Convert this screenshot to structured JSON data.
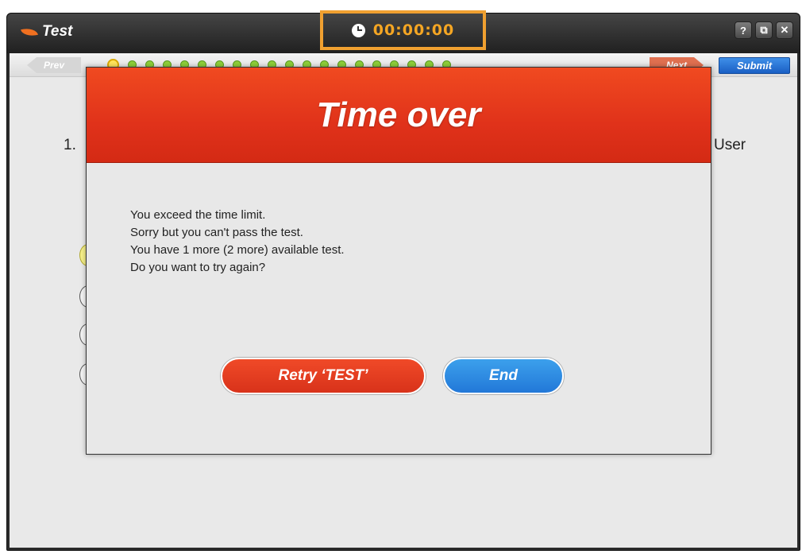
{
  "window": {
    "title": "Test",
    "timer": "00:00:00",
    "buttons": {
      "help": "?",
      "restore": "⧉",
      "close": "✕"
    }
  },
  "nav": {
    "prev_label": "Prev",
    "next_label": "Next",
    "submit_label": "Submit",
    "question_count": 20,
    "current_question": 1
  },
  "question": {
    "number": "1.",
    "trailing_text": "User"
  },
  "modal": {
    "title": "Time over",
    "lines": [
      "You exceed the time limit.",
      "Sorry but you can't pass the test.",
      "You have 1 more (2 more) available test.",
      "Do you want to try again?"
    ],
    "retry_label": "Retry ‘TEST’",
    "end_label": "End"
  },
  "colors": {
    "accent_orange": "#f5a623",
    "modal_header_red": "#e0321a",
    "end_button_blue": "#2e8fe0",
    "progress_dot_green": "#8fcf3a"
  },
  "icons": [
    "leaf-logo-icon",
    "clock-icon",
    "help-icon",
    "restore-icon",
    "close-icon"
  ]
}
